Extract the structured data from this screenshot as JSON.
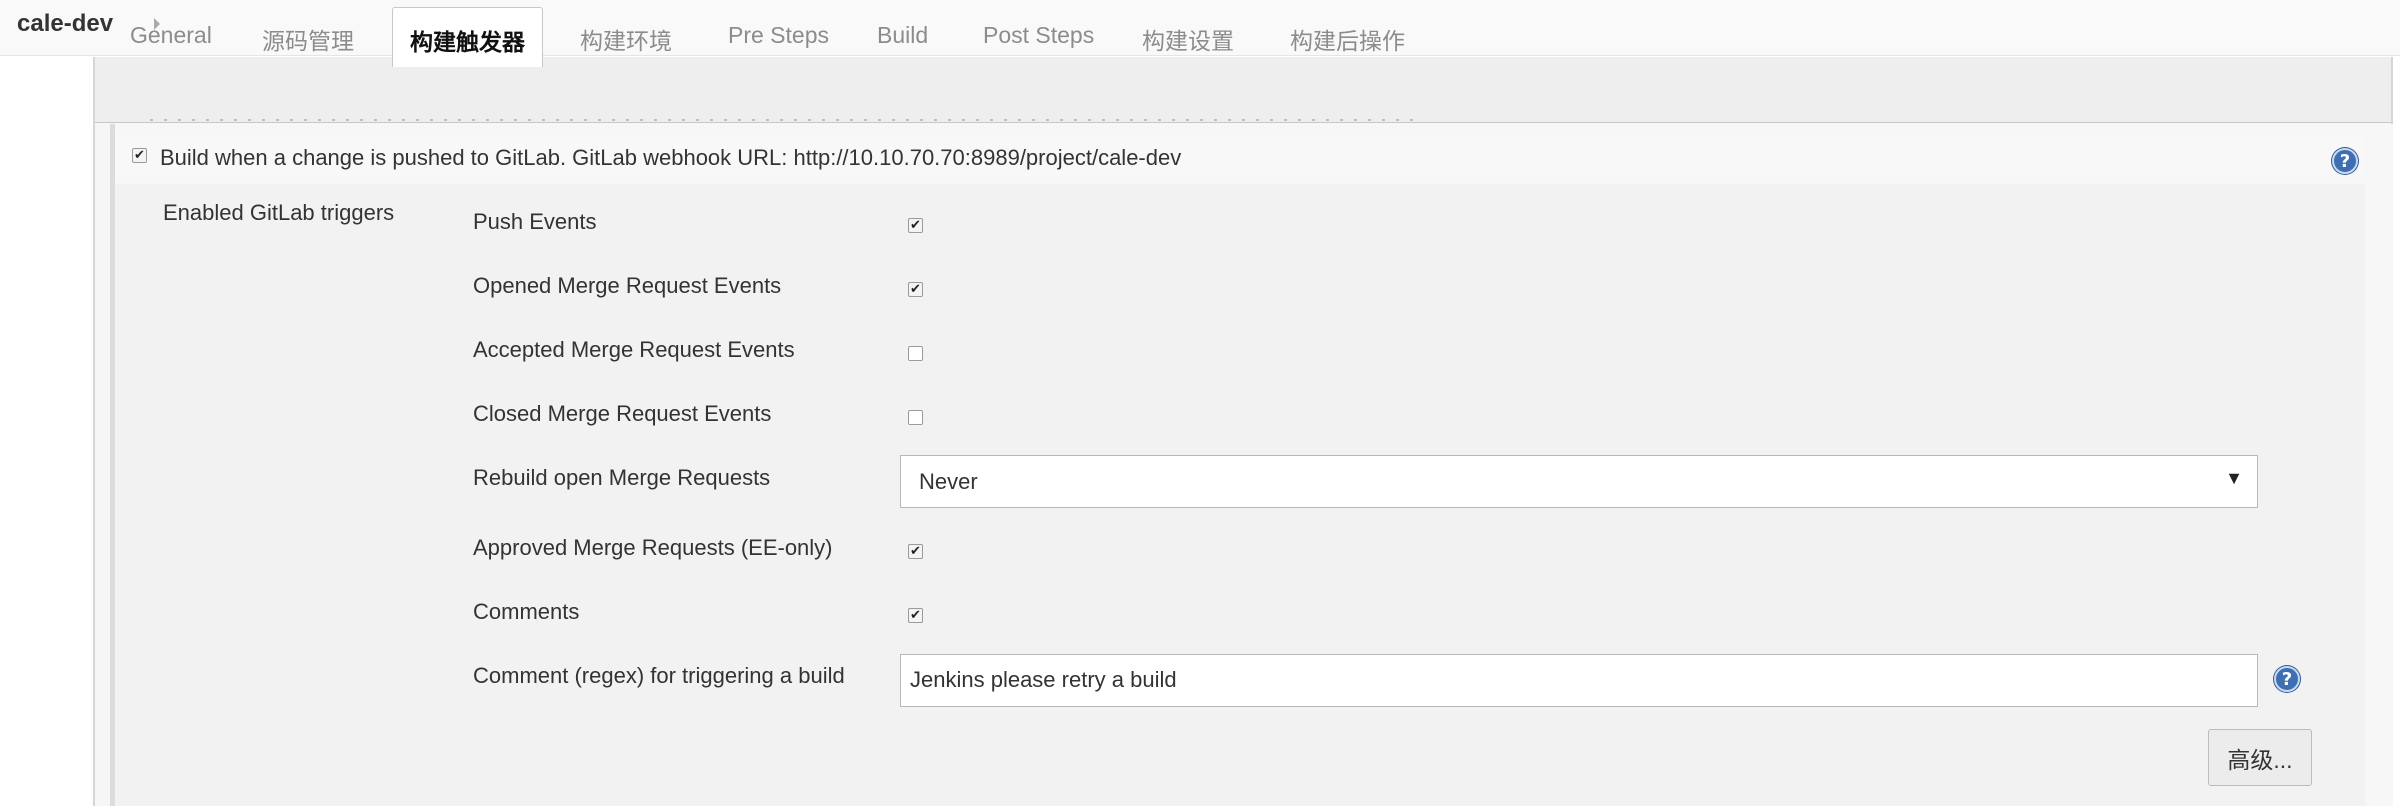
{
  "breadcrumb": {
    "title": "cale-dev"
  },
  "tabs": [
    {
      "label": "General"
    },
    {
      "label": "源码管理"
    },
    {
      "label": "构建触发器"
    },
    {
      "label": "构建环境"
    },
    {
      "label": "Pre Steps"
    },
    {
      "label": "Build"
    },
    {
      "label": "Post Steps"
    },
    {
      "label": "构建设置"
    },
    {
      "label": "构建后操作"
    }
  ],
  "active_tab": "构建触发器",
  "gitlab_trigger": {
    "checked": true,
    "label": "Build when a change is pushed to GitLab. GitLab webhook URL: http://10.10.70.70:8989/project/cale-dev",
    "help_icon": "help-icon"
  },
  "triggers": {
    "section_label": "Enabled GitLab triggers",
    "push_events": {
      "label": "Push Events",
      "checked": true
    },
    "opened_mr_events": {
      "label": "Opened Merge Request Events",
      "checked": true
    },
    "accepted_mr_events": {
      "label": "Accepted Merge Request Events",
      "checked": false
    },
    "closed_mr_events": {
      "label": "Closed Merge Request Events",
      "checked": false
    },
    "rebuild_open_mr": {
      "label": "Rebuild open Merge Requests",
      "selected": "Never"
    },
    "approved_mr": {
      "label": "Approved Merge Requests (EE-only)",
      "checked": true
    },
    "comments": {
      "label": "Comments",
      "checked": true
    },
    "comment_regex": {
      "label": "Comment (regex) for triggering a build",
      "value": "Jenkins please retry a build"
    }
  },
  "advanced_button": "高级...",
  "icons": {
    "help": "help-icon",
    "checkmark": "checkmark-icon",
    "dropdown": "chevron-down-icon",
    "breadcrumb_arrow": "chevron-right-icon"
  },
  "colors": {
    "help_icon_blue": "#3e6fb3",
    "active_tab_text": "#111111",
    "inactive_tab_text": "#8c8c8c"
  }
}
